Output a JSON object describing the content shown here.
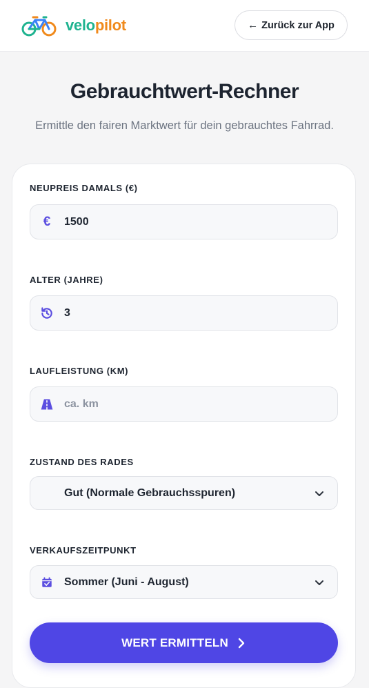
{
  "header": {
    "brand_part1": "velo",
    "brand_part2": "pilot",
    "back_label": "Zurück zur App"
  },
  "page": {
    "title": "Gebrauchtwert-Rechner",
    "subtitle": "Ermittle den fairen Marktwert für dein gebrauchtes Fahrrad."
  },
  "form": {
    "price": {
      "label": "NEUPREIS DAMALS (€)",
      "value": "1500",
      "icon": "euro-icon"
    },
    "age": {
      "label": "ALTER (JAHRE)",
      "value": "3",
      "icon": "history-icon"
    },
    "mileage": {
      "label": "LAUFLEISTUNG (KM)",
      "value": "",
      "placeholder": "ca. km",
      "icon": "road-icon"
    },
    "condition": {
      "label": "ZUSTAND DES RADES",
      "selected": "Gut (Normale Gebrauchsspuren)"
    },
    "season": {
      "label": "VERKAUFSZEITPUNKT",
      "selected": "Sommer (Juni - August)",
      "icon": "calendar-icon"
    },
    "submit_label": "WERT ERMITTELN"
  },
  "colors": {
    "accent": "#4f46e5",
    "brand_green": "#1fb390",
    "brand_orange": "#f08a1c"
  }
}
